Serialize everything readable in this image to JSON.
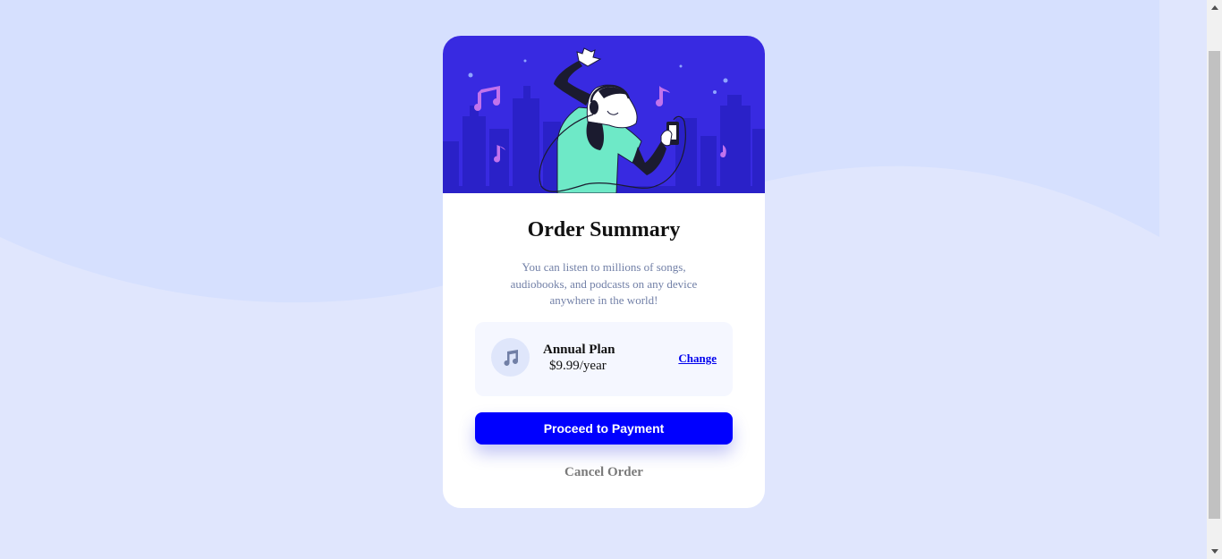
{
  "card": {
    "title": "Order Summary",
    "description": "You can listen to millions of songs, audiobooks, and podcasts on any device anywhere in the world!",
    "plan": {
      "icon": "music-note-icon",
      "name": "Annual Plan",
      "price": "$9.99/year",
      "change_label": "Change"
    },
    "proceed_label": "Proceed to Payment",
    "cancel_label": "Cancel Order"
  },
  "colors": {
    "background": "#e0e6fd",
    "wave": "#d6e0fe",
    "hero_bg": "#382ae1",
    "primary_button": "#0000ff",
    "plan_bg": "#f5f7ff",
    "description_text": "#7280a7"
  }
}
